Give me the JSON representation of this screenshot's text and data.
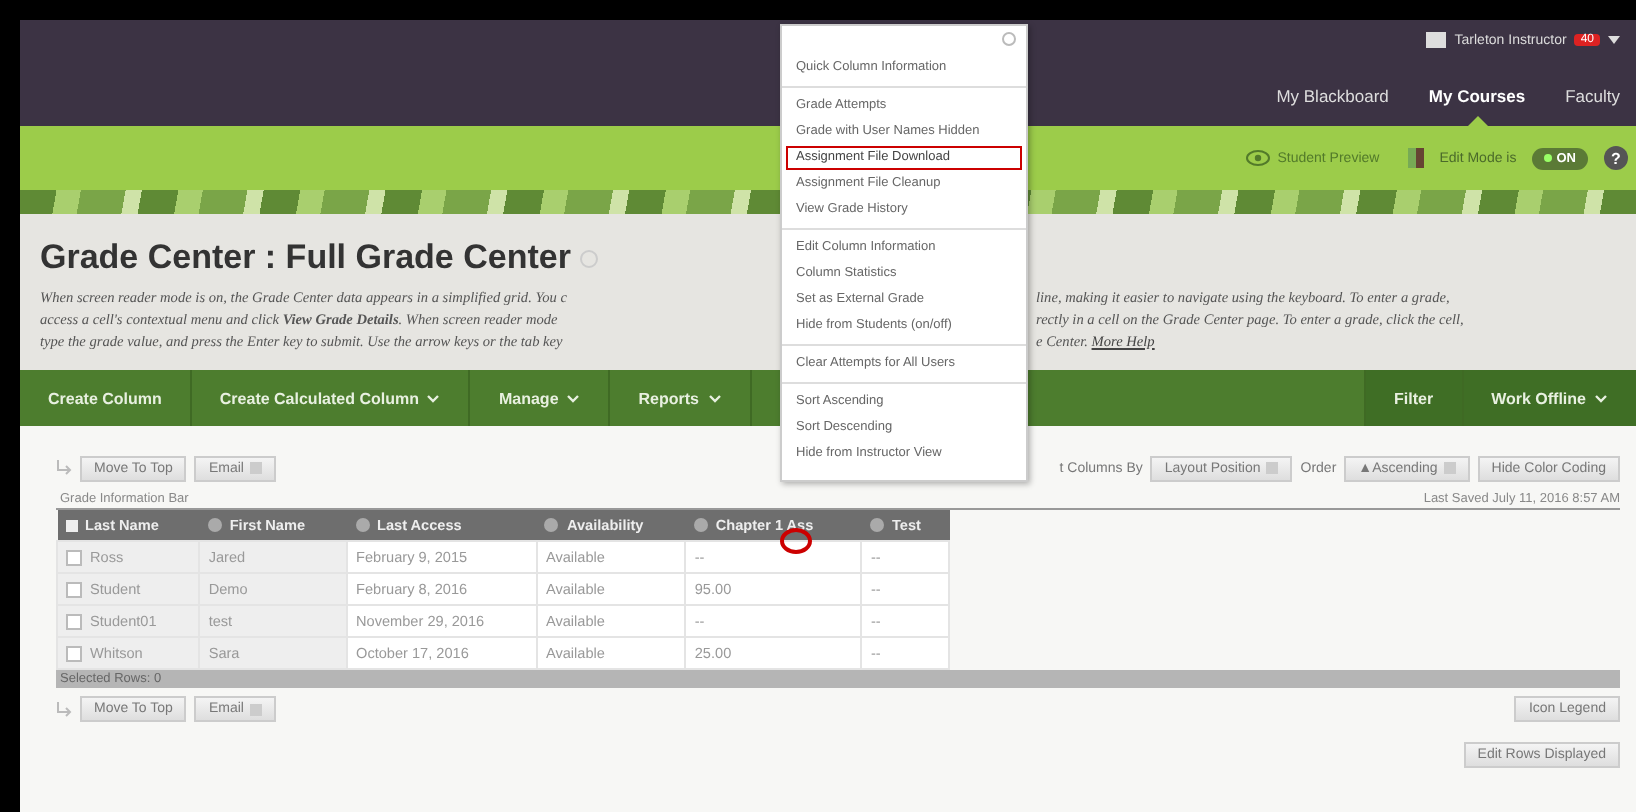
{
  "header": {
    "user": "Tarleton Instructor",
    "badge": "40",
    "nav": [
      {
        "label": "My Blackboard",
        "selected": false
      },
      {
        "label": "My Courses",
        "selected": true
      },
      {
        "label": "Faculty",
        "selected": false
      }
    ]
  },
  "course_bar": {
    "student_preview": "Student Preview",
    "edit_mode_label": "Edit Mode is",
    "edit_mode": true,
    "edit_mode_text": "ON",
    "help": "?"
  },
  "page": {
    "title": "Grade Center : Full Grade Center",
    "description_left": [
      "When screen reader mode is on, the Grade Center data appears in a simplified grid. You c",
      "access a cell's contextual menu and click **View Grade Details**. When screen reader mode",
      "type the grade value, and press the Enter key to submit. Use the arrow keys or the tab key"
    ],
    "description_right": [
      "line, making it easier to navigate using the keyboard. To enter a grade,",
      "rectly in a cell on the Grade Center page. To enter a grade, click the cell,",
      "e Center."
    ],
    "more_help": "More Help"
  },
  "toolbar": {
    "left": [
      {
        "label": "Create Column",
        "dropdown": false
      },
      {
        "label": "Create Calculated Column",
        "dropdown": true
      },
      {
        "label": "Manage",
        "dropdown": true
      },
      {
        "label": "Reports",
        "dropdown": true
      }
    ],
    "right": [
      {
        "label": "Filter",
        "dropdown": false
      },
      {
        "label": "Work Offline",
        "dropdown": true
      }
    ]
  },
  "actions": {
    "move_to_top": "Move To Top",
    "email": "Email",
    "sort_label": "t Columns By",
    "sort_value": "Layout Position",
    "order_label": "Order",
    "order_value": "▲Ascending",
    "hide_color": "Hide Color Coding",
    "info_bar": "Grade Information Bar",
    "last_saved": "Last Saved July 11, 2016 8:57 AM"
  },
  "table": {
    "select_all_checked": false,
    "columns": [
      "Last Name",
      "First Name",
      "Last Access",
      "Availability",
      "Chapter 1 Ass",
      "Test"
    ],
    "rows": [
      {
        "checked": false,
        "cells": [
          "Ross",
          "Jared",
          "February 9, 2015",
          "Available",
          "--",
          "--"
        ]
      },
      {
        "checked": false,
        "cells": [
          "Student",
          "Demo",
          "February 8, 2016",
          "Available",
          "95.00",
          "--"
        ]
      },
      {
        "checked": false,
        "cells": [
          "Student01",
          "test",
          "November 29, 2016",
          "Available",
          "--",
          "--"
        ]
      },
      {
        "checked": false,
        "cells": [
          "Whitson",
          "Sara",
          "October 17, 2016",
          "Available",
          "25.00",
          "--"
        ]
      }
    ],
    "selected_rows": "Selected Rows: 0"
  },
  "bottom": {
    "move_to_top": "Move To Top",
    "email": "Email",
    "icon_legend": "Icon Legend",
    "edit_rows": "Edit Rows Displayed"
  },
  "context_menu": {
    "groups": [
      [
        {
          "label": "Quick Column Information",
          "highlighted": false
        }
      ],
      [
        {
          "label": "Grade Attempts",
          "highlighted": false
        },
        {
          "label": "Grade with User Names Hidden",
          "highlighted": false
        },
        {
          "label": "Assignment File Download",
          "highlighted": true
        },
        {
          "label": "Assignment File Cleanup",
          "highlighted": false
        },
        {
          "label": "View Grade History",
          "highlighted": false
        }
      ],
      [
        {
          "label": "Edit Column Information",
          "highlighted": false
        },
        {
          "label": "Column Statistics",
          "highlighted": false
        },
        {
          "label": "Set as External Grade",
          "highlighted": false
        },
        {
          "label": "Hide from Students (on/off)",
          "highlighted": false
        }
      ],
      [
        {
          "label": "Clear Attempts for All Users",
          "highlighted": false
        }
      ],
      [
        {
          "label": "Sort Ascending",
          "highlighted": false
        },
        {
          "label": "Sort Descending",
          "highlighted": false
        },
        {
          "label": "Hide from Instructor View",
          "highlighted": false
        }
      ]
    ]
  }
}
